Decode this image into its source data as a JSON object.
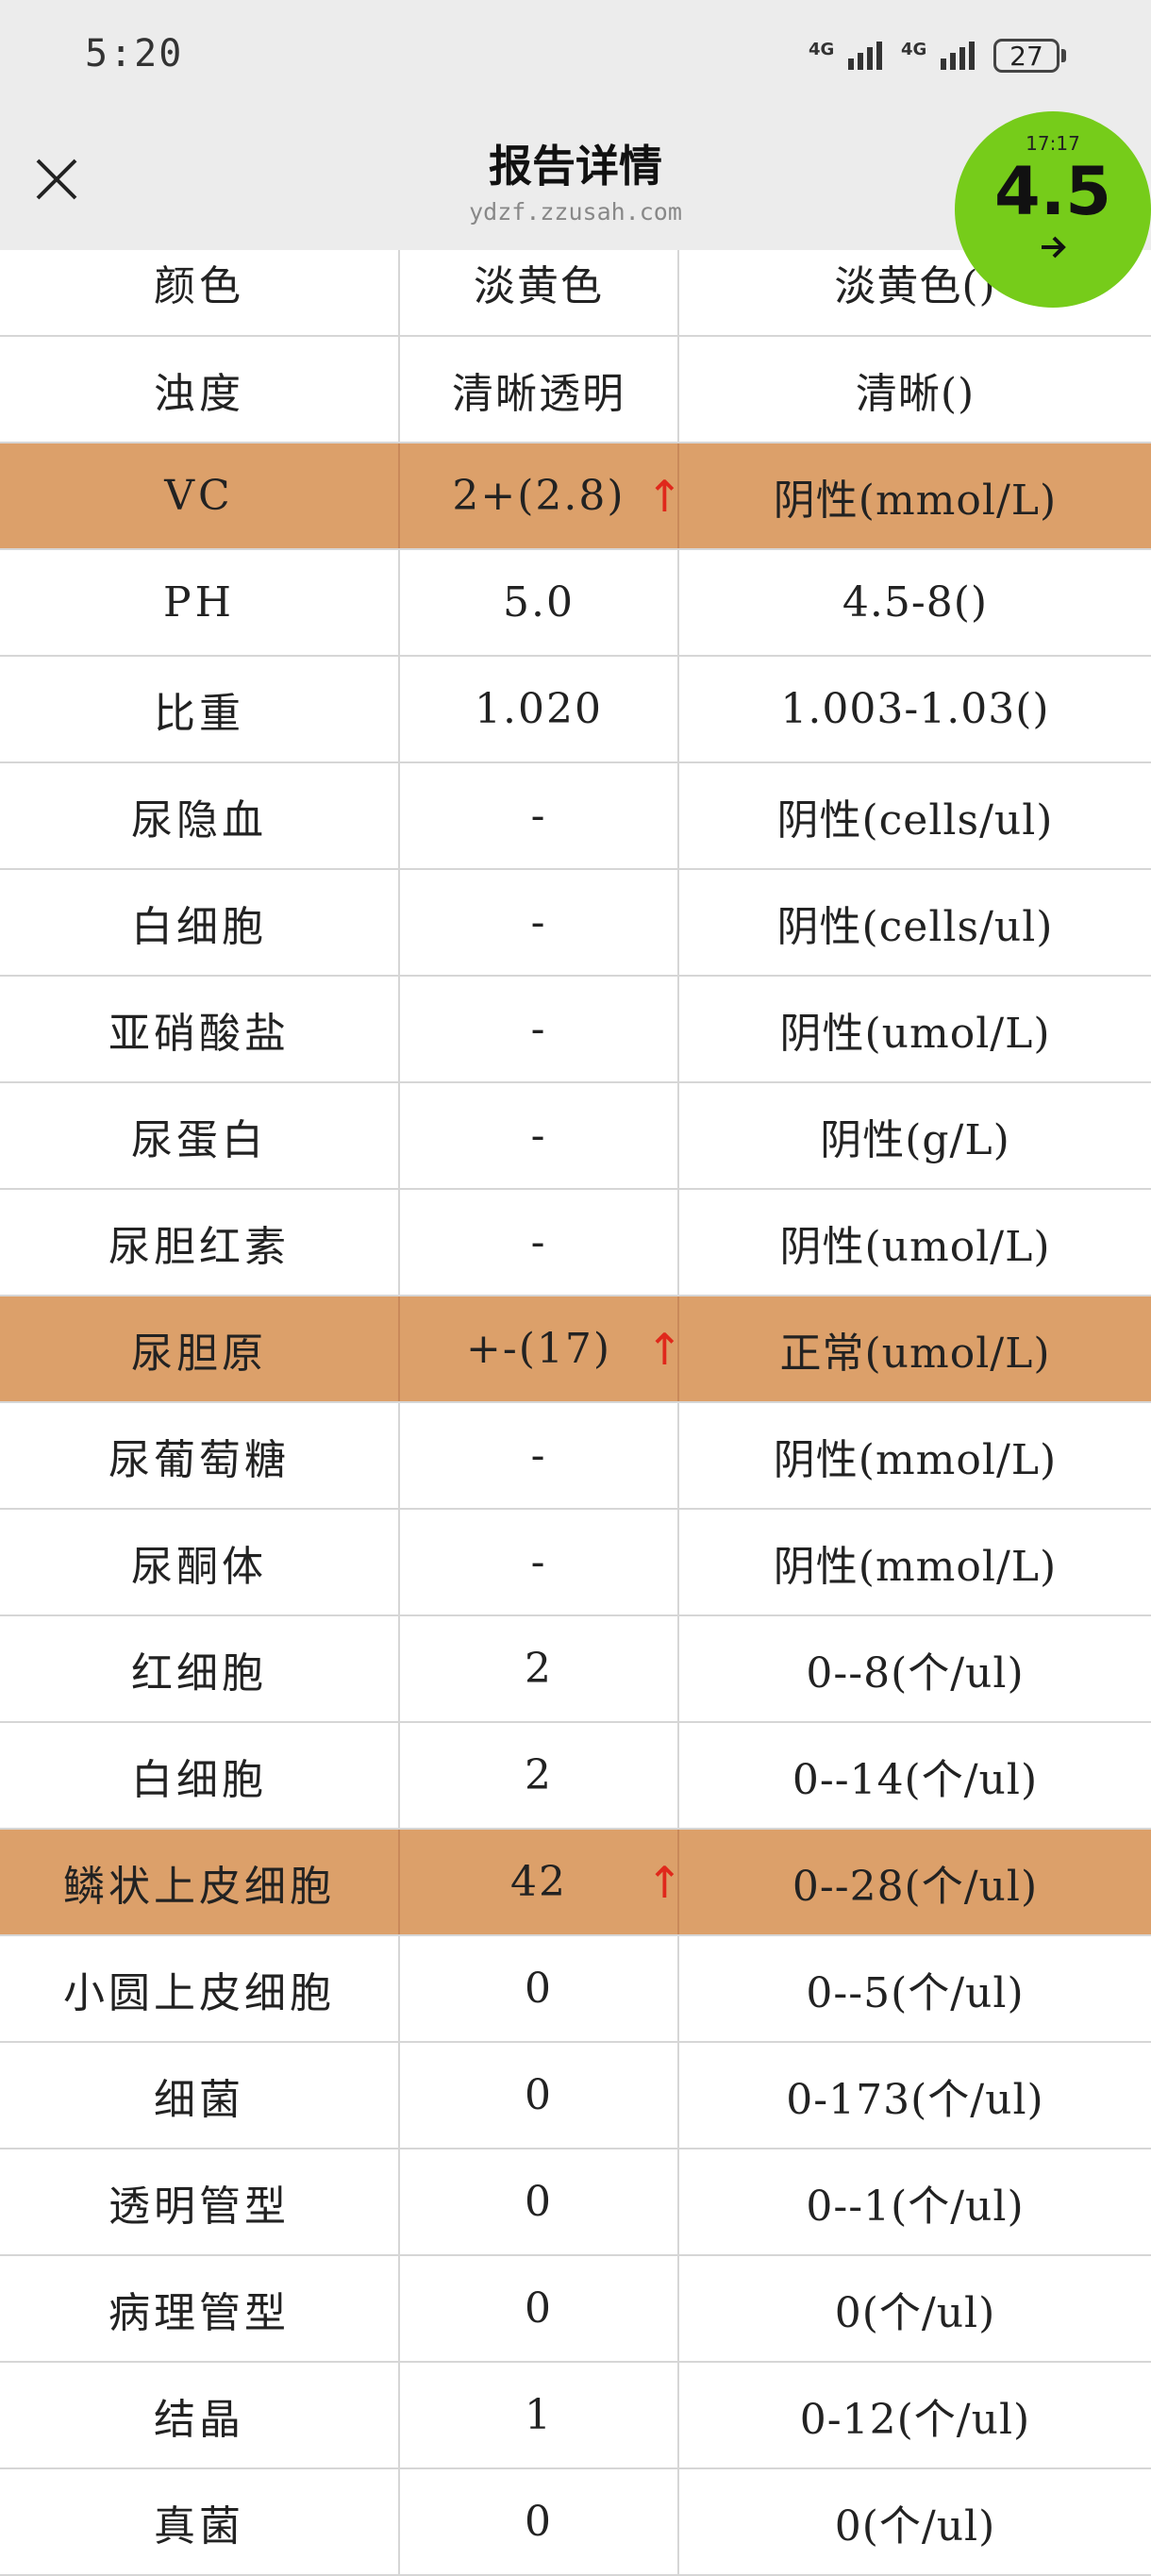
{
  "status_bar": {
    "time": "5:20",
    "signal1_label": "4G",
    "signal2_label": "4G",
    "battery": "27"
  },
  "header": {
    "title": "报告详情",
    "url": "ydzf.zzusah.com",
    "close_icon": "close-icon"
  },
  "badge": {
    "time": "17:17",
    "value": "4.5",
    "icon": "arrow-right-icon",
    "color": "#76cc1a"
  },
  "colors": {
    "abnormal_row": "#dca06a",
    "up_arrow": "#e0281b"
  },
  "rows": [
    {
      "name": "颜色",
      "result": "淡黄色",
      "reference": "淡黄色()",
      "flag": ""
    },
    {
      "name": "浊度",
      "result": "清晰透明",
      "reference": "清晰()",
      "flag": ""
    },
    {
      "name": "VC",
      "result": "2+(2.8)",
      "reference": "阴性(mmol/L)",
      "flag": "↑"
    },
    {
      "name": "PH",
      "result": "5.0",
      "reference": "4.5-8()",
      "flag": ""
    },
    {
      "name": "比重",
      "result": "1.020",
      "reference": "1.003-1.03()",
      "flag": ""
    },
    {
      "name": "尿隐血",
      "result": "-",
      "reference": "阴性(cells/ul)",
      "flag": ""
    },
    {
      "name": "白细胞",
      "result": "-",
      "reference": "阴性(cells/ul)",
      "flag": ""
    },
    {
      "name": "亚硝酸盐",
      "result": "-",
      "reference": "阴性(umol/L)",
      "flag": ""
    },
    {
      "name": "尿蛋白",
      "result": "-",
      "reference": "阴性(g/L)",
      "flag": ""
    },
    {
      "name": "尿胆红素",
      "result": "-",
      "reference": "阴性(umol/L)",
      "flag": ""
    },
    {
      "name": "尿胆原",
      "result": "+-(17)",
      "reference": "正常(umol/L)",
      "flag": "↑"
    },
    {
      "name": "尿葡萄糖",
      "result": "-",
      "reference": "阴性(mmol/L)",
      "flag": ""
    },
    {
      "name": "尿酮体",
      "result": "-",
      "reference": "阴性(mmol/L)",
      "flag": ""
    },
    {
      "name": "红细胞",
      "result": "2",
      "reference": "0--8(个/ul)",
      "flag": ""
    },
    {
      "name": "白细胞",
      "result": "2",
      "reference": "0--14(个/ul)",
      "flag": ""
    },
    {
      "name": "鳞状上皮细胞",
      "result": "42",
      "reference": "0--28(个/ul)",
      "flag": "↑"
    },
    {
      "name": "小圆上皮细胞",
      "result": "0",
      "reference": "0--5(个/ul)",
      "flag": ""
    },
    {
      "name": "细菌",
      "result": "0",
      "reference": "0-173(个/ul)",
      "flag": ""
    },
    {
      "name": "透明管型",
      "result": "0",
      "reference": "0--1(个/ul)",
      "flag": ""
    },
    {
      "name": "病理管型",
      "result": "0",
      "reference": "0(个/ul)",
      "flag": ""
    },
    {
      "name": "结晶",
      "result": "1",
      "reference": "0-12(个/ul)",
      "flag": ""
    },
    {
      "name": "真菌",
      "result": "0",
      "reference": "0(个/ul)",
      "flag": ""
    }
  ]
}
